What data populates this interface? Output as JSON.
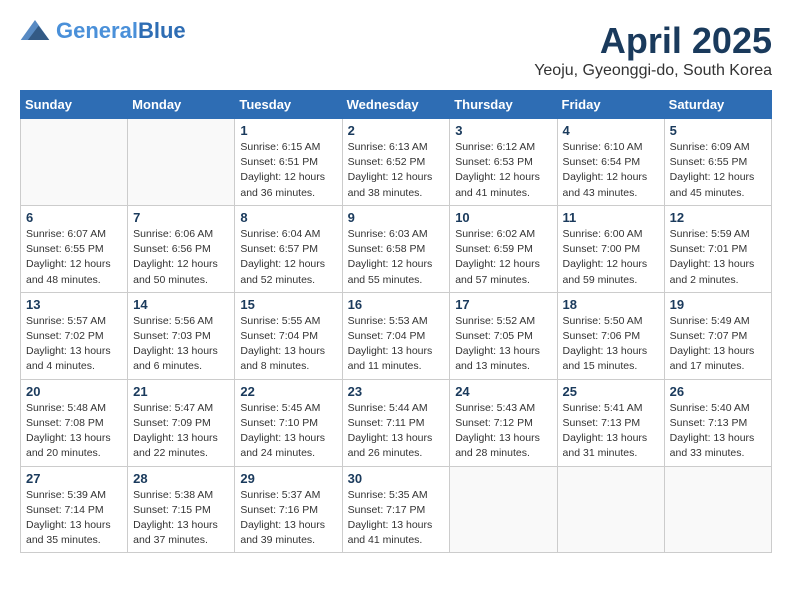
{
  "header": {
    "logo": {
      "general": "General",
      "blue": "Blue"
    },
    "title": "April 2025",
    "location": "Yeoju, Gyeonggi-do, South Korea"
  },
  "weekdays": [
    "Sunday",
    "Monday",
    "Tuesday",
    "Wednesday",
    "Thursday",
    "Friday",
    "Saturday"
  ],
  "weeks": [
    [
      {
        "day": "",
        "info": ""
      },
      {
        "day": "",
        "info": ""
      },
      {
        "day": "1",
        "info": "Sunrise: 6:15 AM\nSunset: 6:51 PM\nDaylight: 12 hours\nand 36 minutes."
      },
      {
        "day": "2",
        "info": "Sunrise: 6:13 AM\nSunset: 6:52 PM\nDaylight: 12 hours\nand 38 minutes."
      },
      {
        "day": "3",
        "info": "Sunrise: 6:12 AM\nSunset: 6:53 PM\nDaylight: 12 hours\nand 41 minutes."
      },
      {
        "day": "4",
        "info": "Sunrise: 6:10 AM\nSunset: 6:54 PM\nDaylight: 12 hours\nand 43 minutes."
      },
      {
        "day": "5",
        "info": "Sunrise: 6:09 AM\nSunset: 6:55 PM\nDaylight: 12 hours\nand 45 minutes."
      }
    ],
    [
      {
        "day": "6",
        "info": "Sunrise: 6:07 AM\nSunset: 6:55 PM\nDaylight: 12 hours\nand 48 minutes."
      },
      {
        "day": "7",
        "info": "Sunrise: 6:06 AM\nSunset: 6:56 PM\nDaylight: 12 hours\nand 50 minutes."
      },
      {
        "day": "8",
        "info": "Sunrise: 6:04 AM\nSunset: 6:57 PM\nDaylight: 12 hours\nand 52 minutes."
      },
      {
        "day": "9",
        "info": "Sunrise: 6:03 AM\nSunset: 6:58 PM\nDaylight: 12 hours\nand 55 minutes."
      },
      {
        "day": "10",
        "info": "Sunrise: 6:02 AM\nSunset: 6:59 PM\nDaylight: 12 hours\nand 57 minutes."
      },
      {
        "day": "11",
        "info": "Sunrise: 6:00 AM\nSunset: 7:00 PM\nDaylight: 12 hours\nand 59 minutes."
      },
      {
        "day": "12",
        "info": "Sunrise: 5:59 AM\nSunset: 7:01 PM\nDaylight: 13 hours\nand 2 minutes."
      }
    ],
    [
      {
        "day": "13",
        "info": "Sunrise: 5:57 AM\nSunset: 7:02 PM\nDaylight: 13 hours\nand 4 minutes."
      },
      {
        "day": "14",
        "info": "Sunrise: 5:56 AM\nSunset: 7:03 PM\nDaylight: 13 hours\nand 6 minutes."
      },
      {
        "day": "15",
        "info": "Sunrise: 5:55 AM\nSunset: 7:04 PM\nDaylight: 13 hours\nand 8 minutes."
      },
      {
        "day": "16",
        "info": "Sunrise: 5:53 AM\nSunset: 7:04 PM\nDaylight: 13 hours\nand 11 minutes."
      },
      {
        "day": "17",
        "info": "Sunrise: 5:52 AM\nSunset: 7:05 PM\nDaylight: 13 hours\nand 13 minutes."
      },
      {
        "day": "18",
        "info": "Sunrise: 5:50 AM\nSunset: 7:06 PM\nDaylight: 13 hours\nand 15 minutes."
      },
      {
        "day": "19",
        "info": "Sunrise: 5:49 AM\nSunset: 7:07 PM\nDaylight: 13 hours\nand 17 minutes."
      }
    ],
    [
      {
        "day": "20",
        "info": "Sunrise: 5:48 AM\nSunset: 7:08 PM\nDaylight: 13 hours\nand 20 minutes."
      },
      {
        "day": "21",
        "info": "Sunrise: 5:47 AM\nSunset: 7:09 PM\nDaylight: 13 hours\nand 22 minutes."
      },
      {
        "day": "22",
        "info": "Sunrise: 5:45 AM\nSunset: 7:10 PM\nDaylight: 13 hours\nand 24 minutes."
      },
      {
        "day": "23",
        "info": "Sunrise: 5:44 AM\nSunset: 7:11 PM\nDaylight: 13 hours\nand 26 minutes."
      },
      {
        "day": "24",
        "info": "Sunrise: 5:43 AM\nSunset: 7:12 PM\nDaylight: 13 hours\nand 28 minutes."
      },
      {
        "day": "25",
        "info": "Sunrise: 5:41 AM\nSunset: 7:13 PM\nDaylight: 13 hours\nand 31 minutes."
      },
      {
        "day": "26",
        "info": "Sunrise: 5:40 AM\nSunset: 7:13 PM\nDaylight: 13 hours\nand 33 minutes."
      }
    ],
    [
      {
        "day": "27",
        "info": "Sunrise: 5:39 AM\nSunset: 7:14 PM\nDaylight: 13 hours\nand 35 minutes."
      },
      {
        "day": "28",
        "info": "Sunrise: 5:38 AM\nSunset: 7:15 PM\nDaylight: 13 hours\nand 37 minutes."
      },
      {
        "day": "29",
        "info": "Sunrise: 5:37 AM\nSunset: 7:16 PM\nDaylight: 13 hours\nand 39 minutes."
      },
      {
        "day": "30",
        "info": "Sunrise: 5:35 AM\nSunset: 7:17 PM\nDaylight: 13 hours\nand 41 minutes."
      },
      {
        "day": "",
        "info": ""
      },
      {
        "day": "",
        "info": ""
      },
      {
        "day": "",
        "info": ""
      }
    ]
  ]
}
